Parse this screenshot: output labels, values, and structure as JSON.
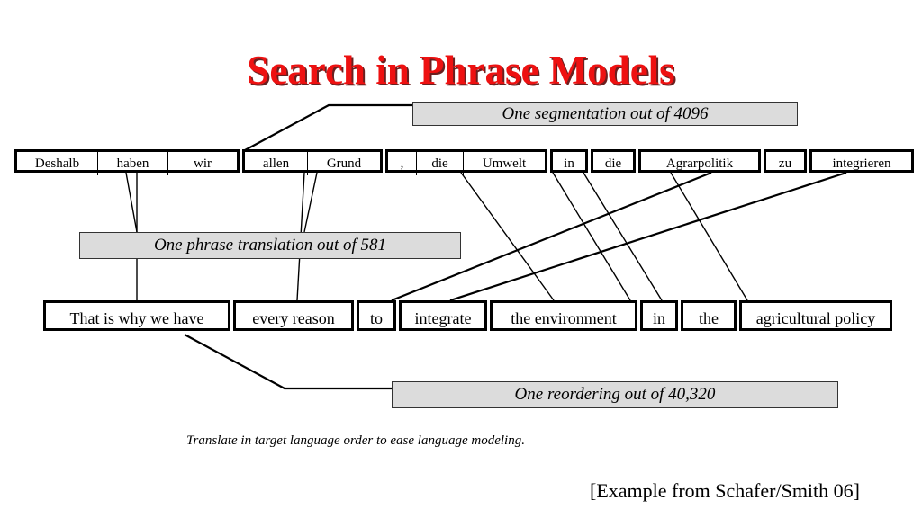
{
  "slide": {
    "title": "Search in Phrase Models",
    "title_color": "#ee1111",
    "callout_fill": "#dcdcdc",
    "caption": "Translate in target language order to ease language modeling.",
    "citation": "[Example from Schafer/Smith 06]"
  },
  "callouts": {
    "segmentation": "One segmentation out of 4096",
    "phrase_translation": "One phrase translation out of 581",
    "reordering": "One reordering out of 40,320"
  },
  "source_sentence": {
    "language": "German",
    "phrases": [
      {
        "tokens": [
          "Deshalb",
          "haben",
          "wir"
        ]
      },
      {
        "tokens": [
          "allen",
          "Grund"
        ]
      },
      {
        "tokens": [
          ",",
          "die",
          "Umwelt"
        ]
      },
      {
        "tokens": [
          "in"
        ]
      },
      {
        "tokens": [
          "die"
        ]
      },
      {
        "tokens": [
          "Agrarpolitik"
        ]
      },
      {
        "tokens": [
          "zu"
        ]
      },
      {
        "tokens": [
          "integrieren"
        ]
      }
    ]
  },
  "target_sentence": {
    "language": "English",
    "phrases": [
      {
        "tokens": [
          "That is why we have"
        ]
      },
      {
        "tokens": [
          "every reason"
        ]
      },
      {
        "tokens": [
          "to"
        ]
      },
      {
        "tokens": [
          "integrate"
        ]
      },
      {
        "tokens": [
          "the environment"
        ]
      },
      {
        "tokens": [
          "in"
        ]
      },
      {
        "tokens": [
          "the"
        ]
      },
      {
        "tokens": [
          "agricultural policy"
        ]
      }
    ]
  },
  "alignment_links": [
    {
      "source_phrase": "Deshalb haben wir",
      "target_phrase": "That is why we have"
    },
    {
      "source_phrase": "allen Grund",
      "target_phrase": "every reason"
    },
    {
      "source_phrase": ", die Umwelt",
      "target_phrase": "the environment"
    },
    {
      "source_phrase": "in",
      "target_phrase": "in"
    },
    {
      "source_phrase": "die",
      "target_phrase": "the"
    },
    {
      "source_phrase": "Agrarpolitik",
      "target_phrase": "agricultural policy"
    },
    {
      "source_phrase": "zu",
      "target_phrase": "to"
    },
    {
      "source_phrase": "integrieren",
      "target_phrase": "integrate"
    }
  ]
}
